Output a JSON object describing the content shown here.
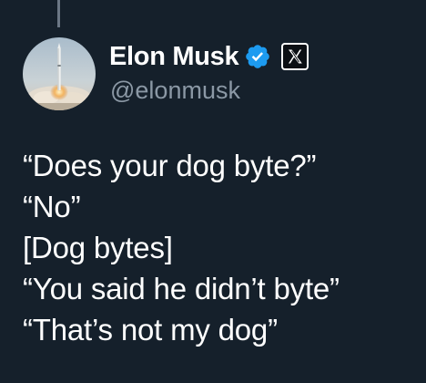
{
  "author": {
    "display_name": "Elon Musk",
    "handle": "@elonmusk",
    "verified": true,
    "affiliate_badge_icon": "x-logo-icon",
    "avatar_icon": "rocket-launch-avatar"
  },
  "tweet": {
    "lines": [
      "“Does your dog byte?”",
      "“No”",
      "[Dog bytes]",
      "“You said he didn’t byte”",
      "“That’s not my dog”"
    ]
  },
  "colors": {
    "background": "#15202b",
    "text_primary": "#ffffff",
    "text_secondary": "#8b98a5",
    "verified_blue": "#1d9bf0",
    "thread_line": "#6b7785"
  }
}
